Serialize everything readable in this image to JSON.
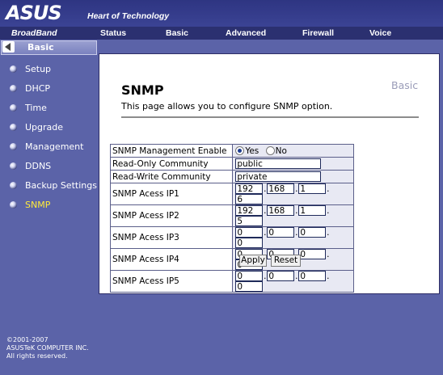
{
  "header": {
    "logo": "ASUS",
    "tagline": "Heart of Technology",
    "broadband": "BroadBand"
  },
  "topnav": [
    "Status",
    "Basic",
    "Advanced",
    "Firewall",
    "Voice"
  ],
  "sidebar": {
    "header": "Basic",
    "items": [
      {
        "label": "Setup"
      },
      {
        "label": "DHCP"
      },
      {
        "label": "Time"
      },
      {
        "label": "Upgrade"
      },
      {
        "label": "Management"
      },
      {
        "label": "DDNS"
      },
      {
        "label": "Backup Settings"
      },
      {
        "label": "SNMP"
      }
    ],
    "active": "SNMP",
    "copyright": [
      "©2001-2007",
      "ASUSTeK COMPUTER INC.",
      "All rights reserved."
    ]
  },
  "page": {
    "title": "SNMP",
    "section": "Basic",
    "description": "This page allows you to configure SNMP option."
  },
  "form": {
    "enable_label": "SNMP Management Enable",
    "yes_label": "Yes",
    "no_label": "No",
    "enabled": "Yes",
    "ro_label": "Read-Only Community",
    "ro_value": "public",
    "rw_label": "Read-Write Community",
    "rw_value": "private",
    "ips": [
      {
        "label": "SNMP Acess IP1",
        "octets": [
          "192",
          "168",
          "1",
          "6"
        ]
      },
      {
        "label": "SNMP Acess IP2",
        "octets": [
          "192",
          "168",
          "1",
          "5"
        ]
      },
      {
        "label": "SNMP Acess IP3",
        "octets": [
          "0",
          "0",
          "0",
          "0"
        ]
      },
      {
        "label": "SNMP Acess IP4",
        "octets": [
          "0",
          "0",
          "0",
          "0"
        ]
      },
      {
        "label": "SNMP Acess IP5",
        "octets": [
          "0",
          "0",
          "0",
          "0"
        ]
      }
    ]
  },
  "buttons": {
    "apply": "Apply",
    "reset": "Reset"
  }
}
